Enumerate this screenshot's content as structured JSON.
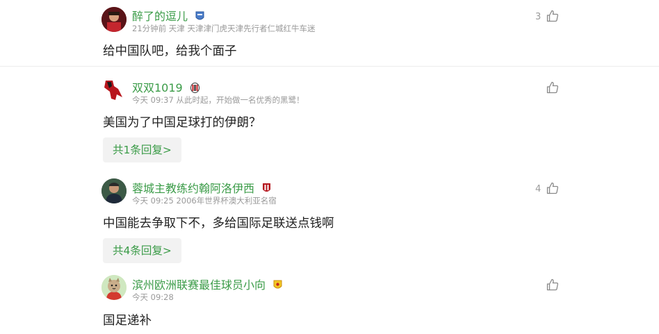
{
  "comments": [
    {
      "username": "醉了的逗儿",
      "badge": "club-badge-blue",
      "meta": "21分钟前 天津 天津津门虎天津先行者仁城红牛车迷",
      "text": "给中国队吧，给我个面子",
      "likes": "3",
      "reply_label": ""
    },
    {
      "username": "双双1019",
      "badge": "ac-milan-badge",
      "meta": "今天 09:37 从此时起，开始做一名优秀的黑鹭！",
      "text": "美国为了中国足球打的伊朗？",
      "likes": "",
      "reply_label": "共1条回复>"
    },
    {
      "username": "蓉城主教练约翰阿洛伊西",
      "badge": "chengdu-rongcheng-badge",
      "meta": "今天 09:25 2006年世界杯澳大利亚名宿",
      "text": "中国能去争取下不，多给国际足联送点钱啊",
      "likes": "4",
      "reply_label": "共4条回复>"
    },
    {
      "username": "滨州欧洲联赛最佳球员小向",
      "badge": "club-badge-yellow",
      "meta": "今天 09:28",
      "text": "国足递补",
      "likes": "",
      "reply_label": ""
    }
  ],
  "colors": {
    "username": "#3a9b47",
    "meta": "#9a9a9a",
    "reply_bg": "#f2f2f2"
  }
}
